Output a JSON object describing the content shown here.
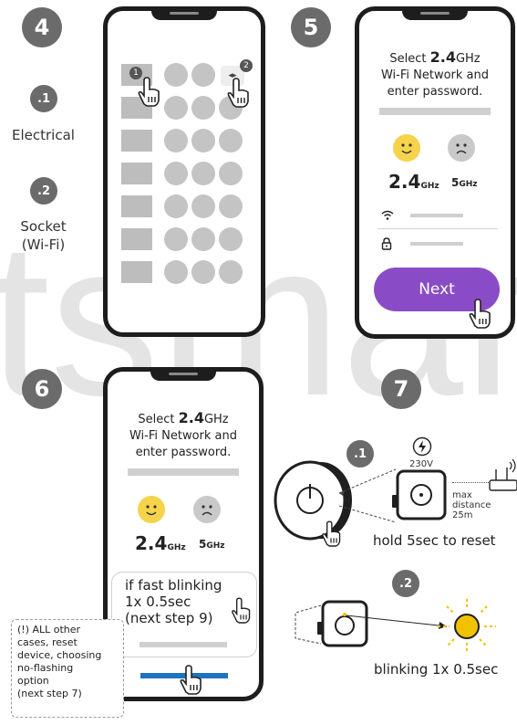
{
  "watermark": "tsmart",
  "steps": {
    "s4": "4",
    "s5": "5",
    "s6": "6",
    "s7": "7"
  },
  "step4": {
    "option1_num": ".1",
    "option1_label": "Electrical",
    "option2_num": ".2",
    "option2_label_line1": "Socket",
    "option2_label_line2": "(Wi-Fi)",
    "marker1": "1",
    "marker2": "2"
  },
  "step5": {
    "title_select": "Select",
    "title_freq": "2.4",
    "title_ghz": "GHz",
    "title_line2": "Wi-Fi Network and",
    "title_line3": "enter password.",
    "freq_24": "2.4",
    "freq_24_unit": "GHz",
    "freq_5": "5",
    "freq_5_unit": "GHz",
    "next_label": "Next",
    "colors": {
      "next": "#8a4cc6",
      "happy": "#f5d34a",
      "sad": "#c9c9c9"
    }
  },
  "step6": {
    "title_select": "Select",
    "title_freq": "2.4",
    "title_ghz": "GHz",
    "title_line2": "Wi-Fi Network and",
    "title_line3": "enter password.",
    "freq_24": "2.4",
    "freq_24_unit": "GHz",
    "freq_5": "5",
    "freq_5_unit": "GHz",
    "popup_line1": "if fast blinking",
    "popup_line2": "1x 0.5sec",
    "popup_line3": "(next step 9)",
    "note_lines": [
      "(!) ALL other",
      "cases, reset",
      "device, choosing",
      "no-flashing",
      "option",
      "(next step 7)"
    ],
    "colors": {
      "bar": "#1e73be"
    }
  },
  "step7": {
    "sub1": ".1",
    "voltage": "230V",
    "max_line1": "max",
    "max_line2": "distance",
    "max_line3": "25m",
    "caption1": "hold 5sec to reset",
    "sub2": ".2",
    "caption2": "blinking 1x 0.5sec",
    "colors": {
      "led": "#f2c200"
    }
  }
}
